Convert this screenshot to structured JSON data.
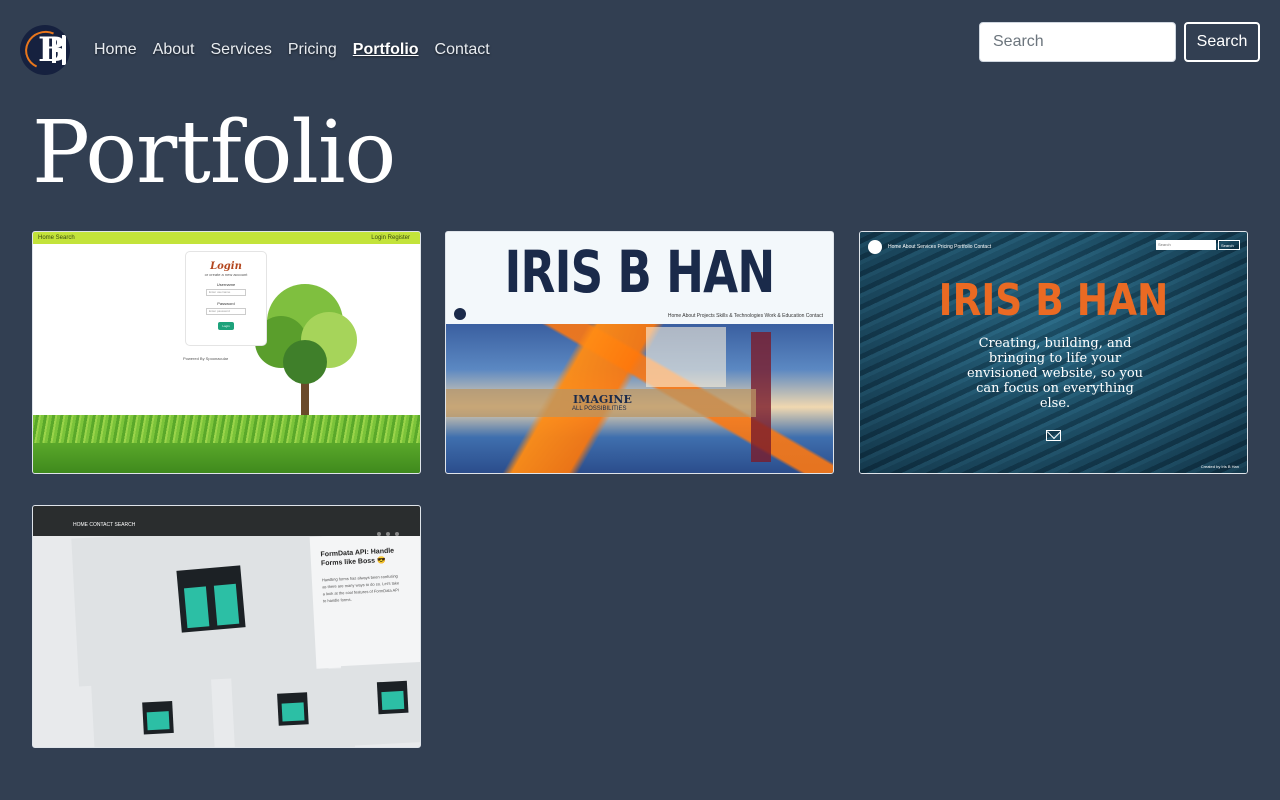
{
  "brand": {
    "logo_icon": "logo-icon"
  },
  "nav": {
    "items": [
      {
        "label": "Home",
        "active": false
      },
      {
        "label": "About",
        "active": false
      },
      {
        "label": "Services",
        "active": false
      },
      {
        "label": "Pricing",
        "active": false
      },
      {
        "label": "Portfolio",
        "active": true
      },
      {
        "label": "Contact",
        "active": false
      }
    ]
  },
  "search": {
    "placeholder": "Search",
    "button_label": "Search"
  },
  "page": {
    "title": "Portfolio"
  },
  "colors": {
    "background": "#323f52",
    "accent": "#ea6a23"
  },
  "portfolio": {
    "items": [
      {
        "kind": "login-page",
        "bar_left": "Home  Search",
        "bar_right": "Login   Register",
        "login_title": "Login",
        "login_sub": "or create a new account",
        "username_label": "Username",
        "username_placeholder": "Enter username",
        "password_label": "Password",
        "password_placeholder": "Enter password",
        "login_button": "Login",
        "powered_by": "Powered By  Spoonacular"
      },
      {
        "kind": "imagine-site",
        "title": "IRIS B HAN",
        "nav": "Home  About  Projects  Skills & Technologies  Work & Education  Contact",
        "band_title": "IMAGINE",
        "band_sub": "ALL POSSIBILITIES"
      },
      {
        "kind": "sand-site",
        "nav": "Home  About  Services  Pricing  Portfolio  Contact",
        "search_placeholder": "Search",
        "search_button": "Search",
        "title": "IRIS B HAN",
        "tagline": "Creating, building, and bringing to life your envisioned website, so you can focus on everything else.",
        "footer": "Created by Iris B Han"
      },
      {
        "kind": "blog-site",
        "nav": "HOME   CONTACT   SEARCH",
        "post_title": "FormData API: Handle Forms like Boss 😎",
        "post_excerpt": "Handling forms has always been confusing as there are many ways to do so. Let's take a look at the cool features of FormData API to handle forms."
      }
    ]
  }
}
